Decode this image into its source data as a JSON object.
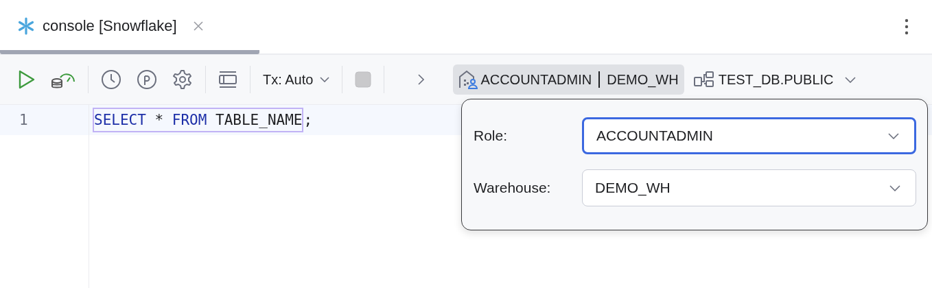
{
  "tab": {
    "title": "console [Snowflake]",
    "selected": true
  },
  "toolbar": {
    "tx_mode": "Tx: Auto",
    "session": {
      "role": "ACCOUNTADMIN",
      "warehouse": "DEMO_WH",
      "expanded": true
    },
    "schema": "TEST_DB.PUBLIC"
  },
  "editor": {
    "lines": [
      {
        "number": "1",
        "statement_highlighted": true,
        "tokens": [
          {
            "text": "SELECT",
            "kind": "keyword"
          },
          {
            "text": " * ",
            "kind": "plain"
          },
          {
            "text": "FROM",
            "kind": "keyword"
          },
          {
            "text": " TABLE_NAME",
            "kind": "plain"
          }
        ],
        "suffix": ";"
      }
    ]
  },
  "popup": {
    "fields": [
      {
        "label": "Role:",
        "value": "ACCOUNTADMIN",
        "focused": true
      },
      {
        "label": "Warehouse:",
        "value": "DEMO_WH",
        "focused": false
      }
    ]
  }
}
